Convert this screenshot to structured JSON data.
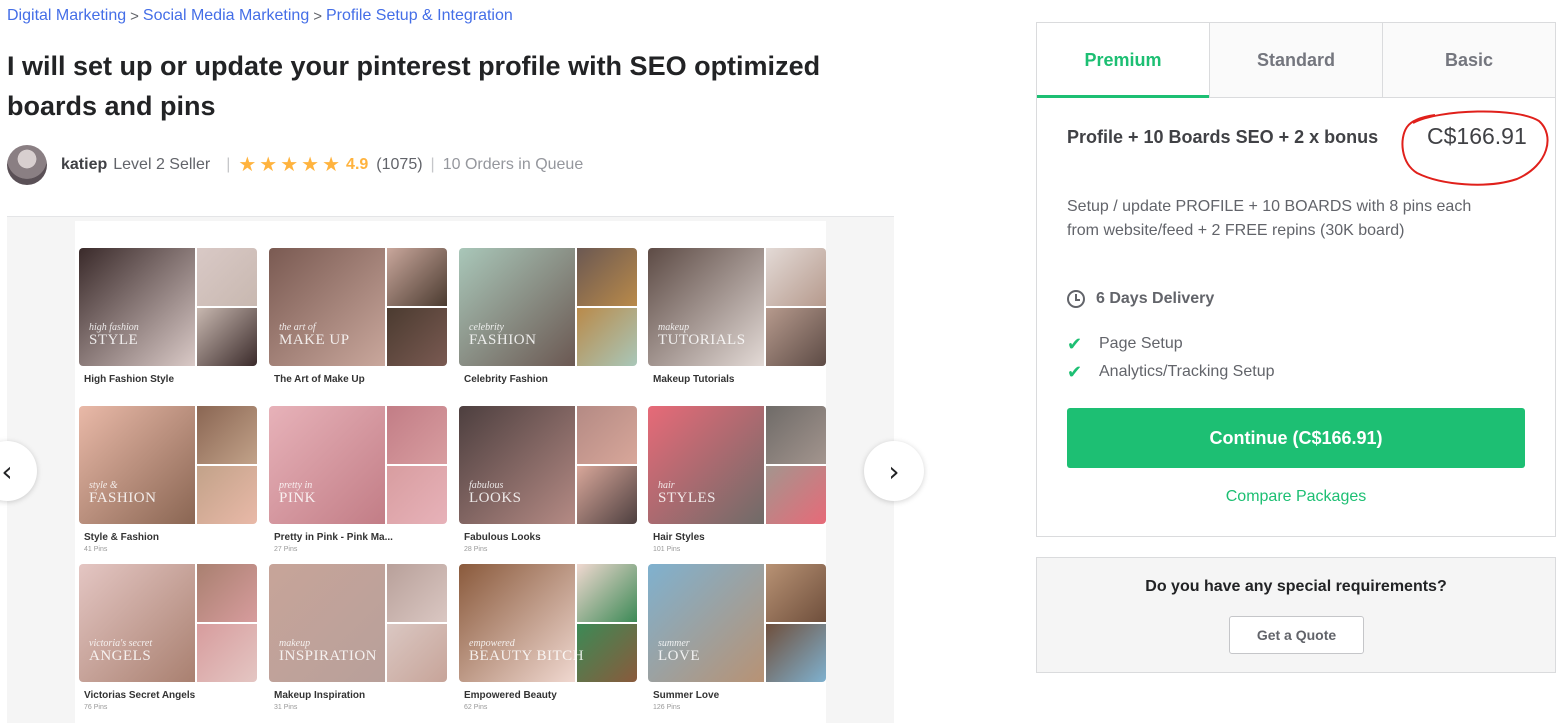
{
  "breadcrumb": {
    "items": [
      "Digital Marketing",
      "Social Media Marketing",
      "Profile Setup & Integration"
    ],
    "separator": ">"
  },
  "gig": {
    "title": "I will set up or update your pinterest profile with SEO optimized boards and pins"
  },
  "seller": {
    "username": "katiep",
    "level": "Level 2 Seller",
    "rating": "4.9",
    "rating_count": "(1075)",
    "stars": 5,
    "orders_in_queue": "10 Orders in Queue"
  },
  "gallery": {
    "prev_icon": "chevron-left-icon",
    "next_icon": "chevron-right-icon",
    "boards": [
      {
        "name": "High Fashion Style",
        "small": "high fashion",
        "big": "STYLE",
        "pins": "",
        "colors": [
          "#3a2a2a",
          "#d9c9c6",
          "#c8b8b0"
        ]
      },
      {
        "name": "The Art of Make Up",
        "small": "the art of",
        "big": "MAKE UP",
        "pins": "",
        "colors": [
          "#7a5a52",
          "#c9a79c",
          "#4b3b30"
        ]
      },
      {
        "name": "Celebrity Fashion",
        "small": "celebrity",
        "big": "FASHION",
        "pins": "",
        "colors": [
          "#a9c7b9",
          "#6b5852",
          "#b98a4a"
        ]
      },
      {
        "name": "Makeup Tutorials",
        "small": "makeup",
        "big": "TUTORIALS",
        "pins": "",
        "colors": [
          "#5d4b45",
          "#e3dad6",
          "#b69a8d"
        ]
      },
      {
        "name": "Style & Fashion",
        "small": "style &",
        "big": "FASHION",
        "pins": "41 Pins",
        "colors": [
          "#e9b9a8",
          "#8a6653",
          "#c2a289"
        ]
      },
      {
        "name": "Pretty in Pink - Pink Ma...",
        "small": "pretty in",
        "big": "PINK",
        "pins": "27 Pins",
        "colors": [
          "#e7b2b9",
          "#c27d86",
          "#d89da0"
        ]
      },
      {
        "name": "Fabulous Looks",
        "small": "fabulous",
        "big": "LOOKS",
        "pins": "28 Pins",
        "colors": [
          "#4d3f3f",
          "#b48a84",
          "#d8a79a"
        ]
      },
      {
        "name": "Hair Styles",
        "small": "hair",
        "big": "STYLES",
        "pins": "101 Pins",
        "colors": [
          "#e76a78",
          "#6f6b68",
          "#a3958e"
        ]
      },
      {
        "name": "Victorias Secret Angels",
        "small": "victoria's secret",
        "big": "ANGELS",
        "pins": "76 Pins",
        "colors": [
          "#e4c6c3",
          "#a98070",
          "#d79c9d"
        ]
      },
      {
        "name": "Makeup Inspiration",
        "small": "makeup",
        "big": "INSPIRATION",
        "pins": "31 Pins",
        "colors": [
          "#c7a499",
          "#b8a09a",
          "#dac7c2"
        ]
      },
      {
        "name": "Empowered Beauty",
        "small": "empowered",
        "big": "BEAUTY BITCH",
        "pins": "62 Pins",
        "colors": [
          "#8a5a3c",
          "#f0d8d0",
          "#3c8a56"
        ]
      },
      {
        "name": "Summer Love",
        "small": "summer",
        "big": "LOVE",
        "pins": "126 Pins",
        "colors": [
          "#7fb1cf",
          "#b89274",
          "#6f4f3c"
        ]
      }
    ]
  },
  "package": {
    "tabs": [
      "Premium",
      "Standard",
      "Basic"
    ],
    "active_tab": "Premium",
    "name": "Profile + 10 Boards SEO + 2 x bonus",
    "price": "C$166.91",
    "description": "Setup / update PROFILE + 10 BOARDS with 8 pins each from website/feed + 2 FREE repins (30K board)",
    "delivery": "6 Days Delivery",
    "delivery_icon": "clock-icon",
    "features": [
      "Page Setup",
      "Analytics/Tracking Setup"
    ],
    "feature_icon": "check-icon",
    "continue_label": "Continue (C$166.91)",
    "compare_label": "Compare Packages",
    "accent_color": "#1dbf73",
    "annotation_color": "#e0201b"
  },
  "quote": {
    "question": "Do you have any special requirements?",
    "button_label": "Get a Quote"
  }
}
